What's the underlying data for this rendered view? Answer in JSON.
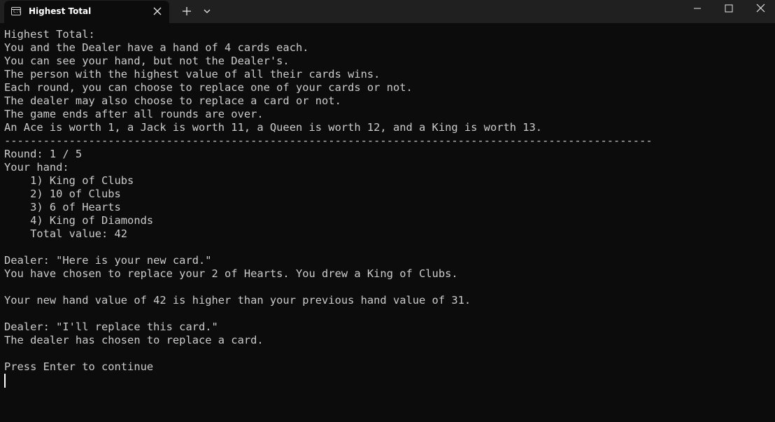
{
  "window": {
    "tab_title": "Highest Total",
    "tab_icon_text": "C:\\"
  },
  "terminal": {
    "lines": [
      "Highest Total:",
      "You and the Dealer have a hand of 4 cards each.",
      "You can see your hand, but not the Dealer's.",
      "The person with the highest value of all their cards wins.",
      "Each round, you can choose to replace one of your cards or not.",
      "The dealer may also choose to replace a card or not.",
      "The game ends after all rounds are over.",
      "An Ace is worth 1, a Jack is worth 11, a Queen is worth 12, and a King is worth 13.",
      "----------------------------------------------------------------------------------------------------",
      "Round: 1 / 5",
      "Your hand:",
      "    1) King of Clubs",
      "    2) 10 of Clubs",
      "    3) 6 of Hearts",
      "    4) King of Diamonds",
      "    Total value: 42",
      "",
      "Dealer: \"Here is your new card.\"",
      "You have chosen to replace your 2 of Hearts. You drew a King of Clubs.",
      "",
      "Your new hand value of 42 is higher than your previous hand value of 31.",
      "",
      "Dealer: \"I'll replace this card.\"",
      "The dealer has chosen to replace a card.",
      "",
      "Press Enter to continue"
    ]
  }
}
